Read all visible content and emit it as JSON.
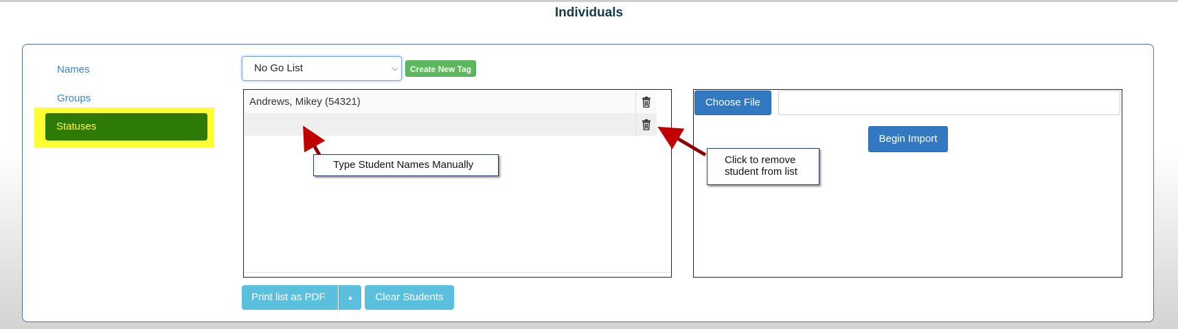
{
  "page": {
    "title": "Individuals"
  },
  "sidebar": {
    "items": [
      {
        "label": "Names"
      },
      {
        "label": "Groups"
      },
      {
        "label": "Statuses"
      }
    ]
  },
  "toolbar": {
    "tag_select_value": "No Go List",
    "create_tag_label": "Create New Tag"
  },
  "student_list": {
    "rows": [
      {
        "name": "Andrews, Mikey (54321)"
      },
      {
        "name": ""
      }
    ]
  },
  "import": {
    "choose_file_label": "Choose File",
    "file_name": "",
    "begin_import_label": "Begin Import"
  },
  "actions": {
    "print_label": "Print list as PDF",
    "clear_label": "Clear Students"
  },
  "annotations": {
    "manual_entry": "Type Student Names Manually",
    "remove_line1": "Click to remove",
    "remove_line2": "student from list"
  },
  "colors": {
    "active_bg": "#2e7a06",
    "active_text": "#fffb3a",
    "highlight": "#ffff33",
    "link": "#3d84c4",
    "primary": "#3379c2",
    "success": "#5cb85c",
    "info": "#5bc0de",
    "arrow": "#c00000"
  }
}
